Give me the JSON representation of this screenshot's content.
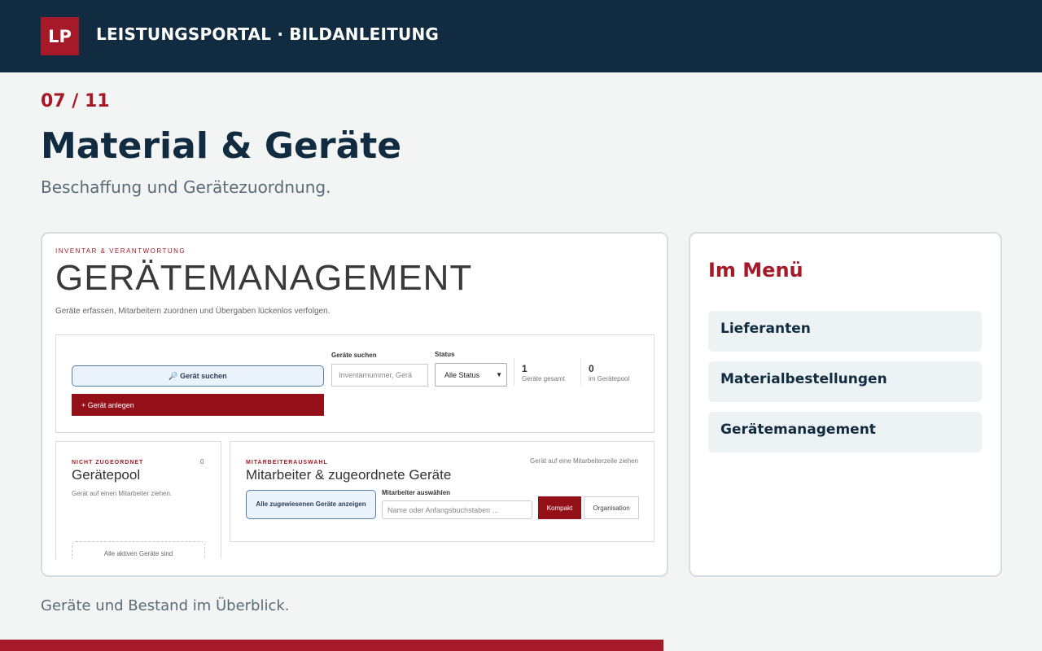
{
  "header": {
    "logo": "LP",
    "title": "LEISTUNGSPORTAL · BILDANLEITUNG"
  },
  "step": {
    "label": "07 / 11",
    "current": 7,
    "total": 11
  },
  "page": {
    "title": "Material & Geräte",
    "subtitle": "Beschaffung und Gerätezuordnung.",
    "caption": "Geräte und Bestand im Überblick."
  },
  "screenshot": {
    "kicker": "INVENTAR & VERANTWORTUNG",
    "title": "GERÄTEMANAGEMENT",
    "description": "Geräte erfassen, Mitarbeitern zuordnen und Übergaben lückenlos verfolgen.",
    "toolbar": {
      "search_button": "🔎 Gerät suchen",
      "add_button": "+ Gerät anlegen",
      "search_label": "Geräte suchen",
      "search_placeholder": "Inventarnummer, Gerä",
      "status_label": "Status",
      "status_value": "Alle Status",
      "stats": [
        {
          "value": "1",
          "label": "Geräte gesamt"
        },
        {
          "value": "0",
          "label": "im Gerätepool"
        }
      ]
    },
    "pool": {
      "kicker": "NICHT ZUGEORDNET",
      "count": "0",
      "title": "Gerätepool",
      "hint": "Gerät auf einen Mitarbeiter ziehen.",
      "empty": "Alle aktiven Geräte sind"
    },
    "employees": {
      "kicker": "MITARBEITERAUSWAHL",
      "hint": "Gerät auf eine Mitarbeiterzeile ziehen",
      "title": "Mitarbeiter & zugeordnete Geräte",
      "show_all": "Alle zugewiesenen Geräte anzeigen",
      "select_label": "Mitarbeiter auswählen",
      "select_placeholder": "Name oder Anfangsbuchstaben ...",
      "kompakt": "Kompakt",
      "organisation": "Organisation"
    }
  },
  "sidebar": {
    "title": "Im Menü",
    "items": [
      {
        "label": "Lieferanten"
      },
      {
        "label": "Materialbestellungen"
      },
      {
        "label": "Gerätemanagement"
      }
    ]
  },
  "colors": {
    "brand_dark": "#112b40",
    "accent": "#a51928",
    "button_red": "#931019"
  }
}
